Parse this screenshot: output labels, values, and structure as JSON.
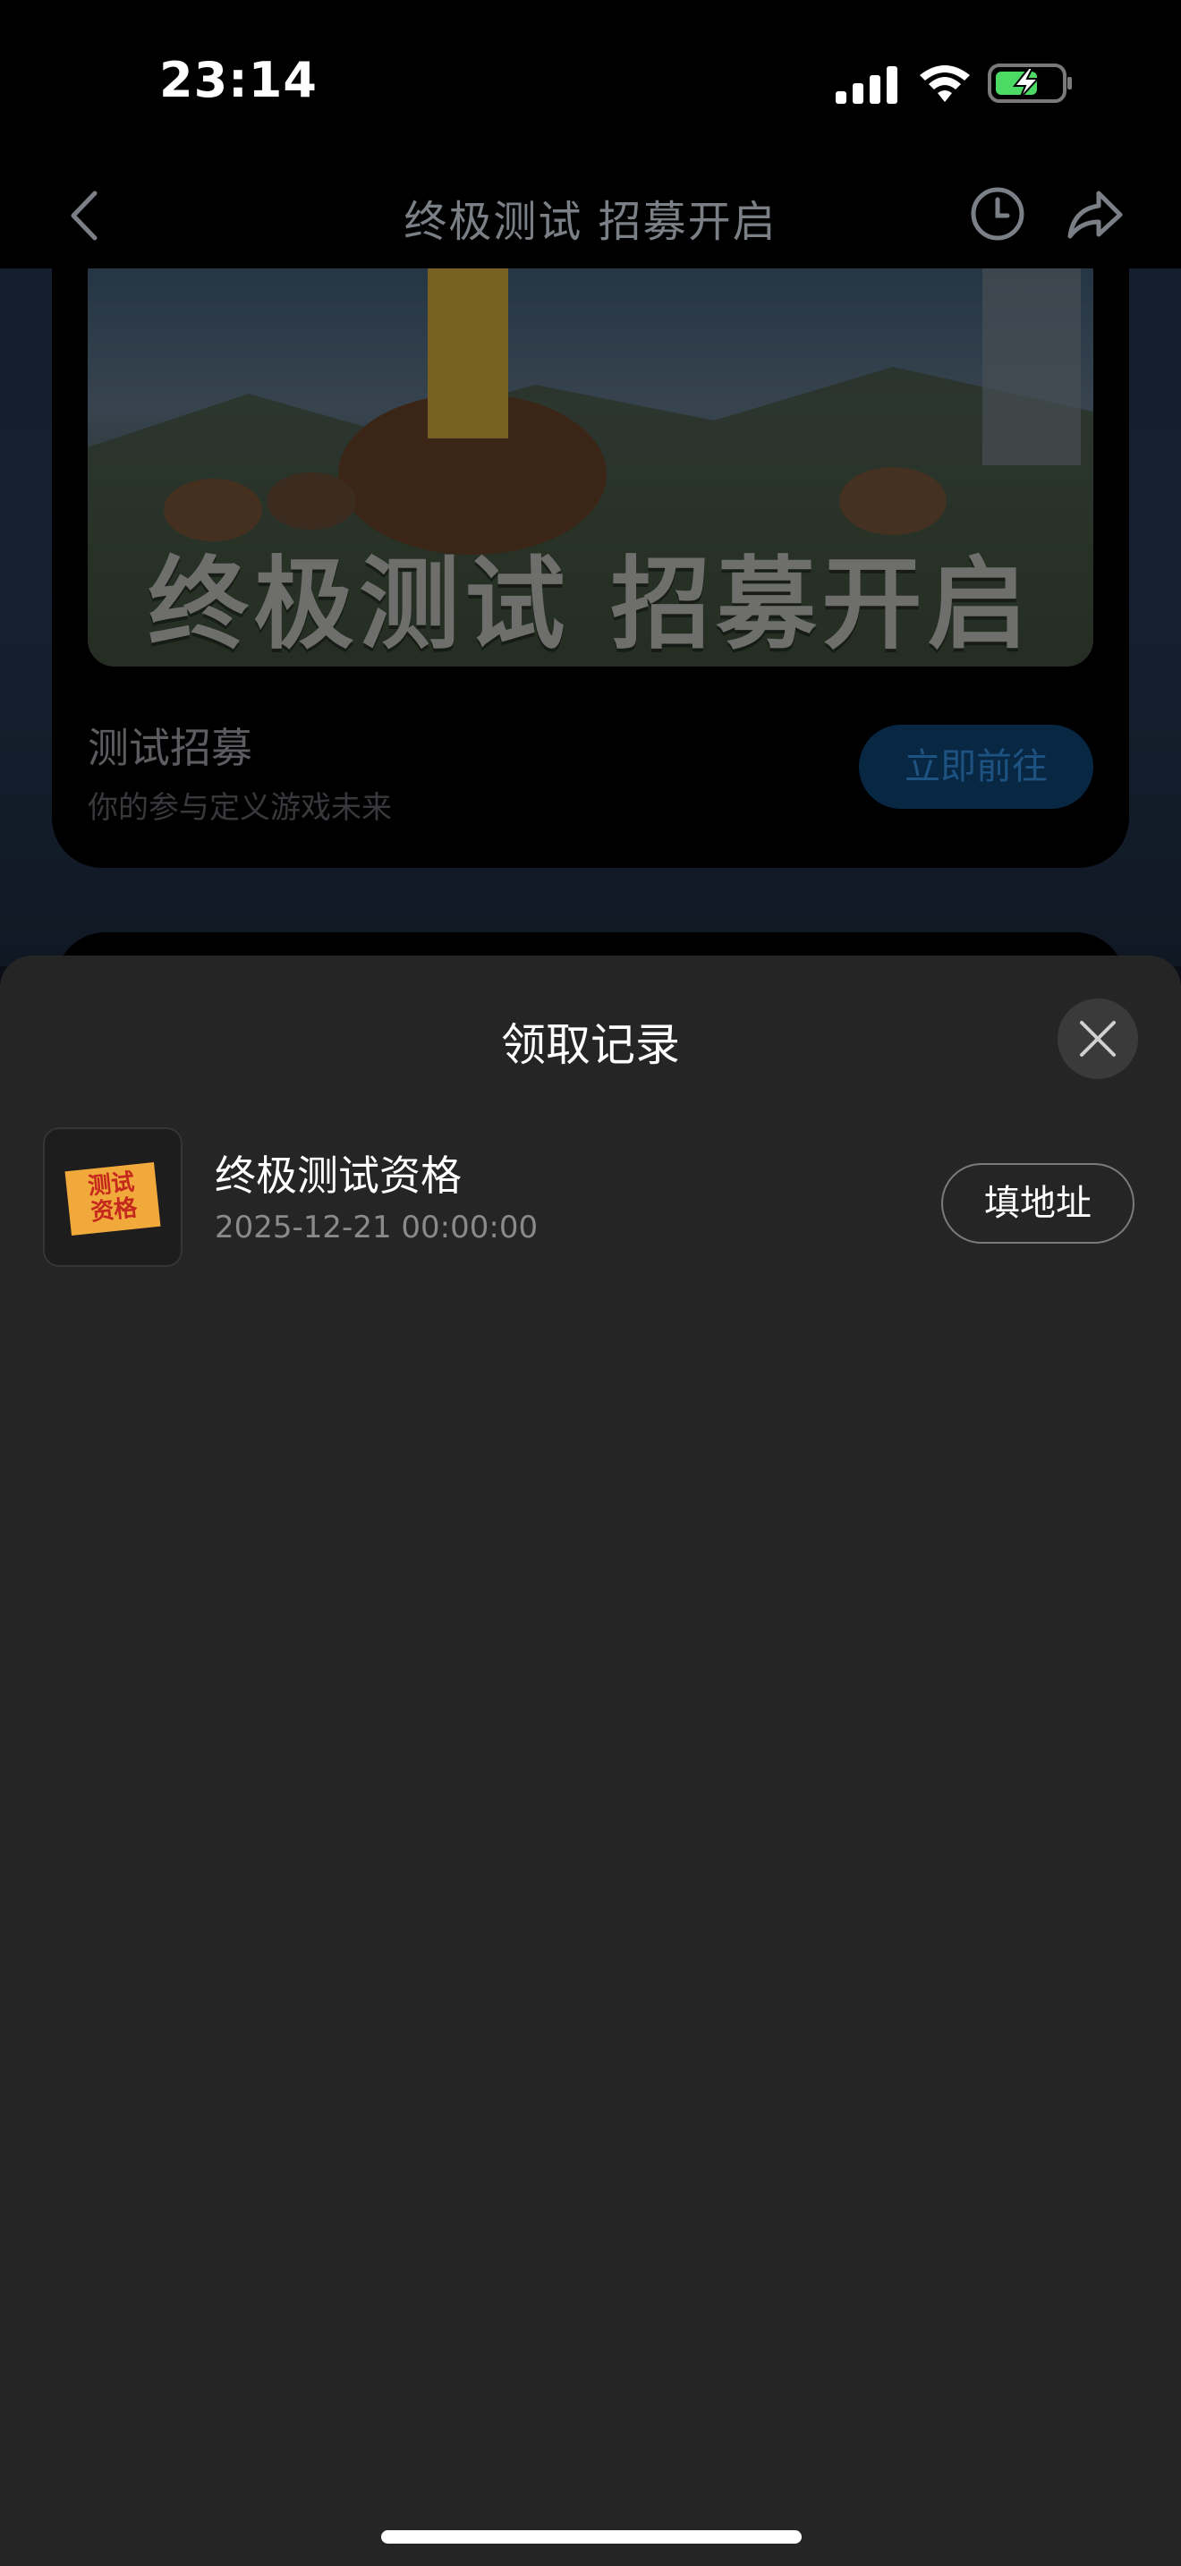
{
  "status_bar": {
    "time": "23:14"
  },
  "nav": {
    "title": "终极测试 招募开启"
  },
  "banner": {
    "text": "终极测试 招募开启"
  },
  "card": {
    "title": "测试招募",
    "subtitle": "你的参与定义游戏未来",
    "button_label": "立即前往"
  },
  "sheet": {
    "title": "领取记录",
    "record": {
      "icon_text": "测试\n资格",
      "title": "终极测试资格",
      "date": "2025-12-21 00:00:00",
      "button_label": "填地址"
    }
  },
  "colors": {
    "sheet_bg": "#252525",
    "accent_button": "#0d3d68",
    "ticket": "#f2a93b"
  }
}
